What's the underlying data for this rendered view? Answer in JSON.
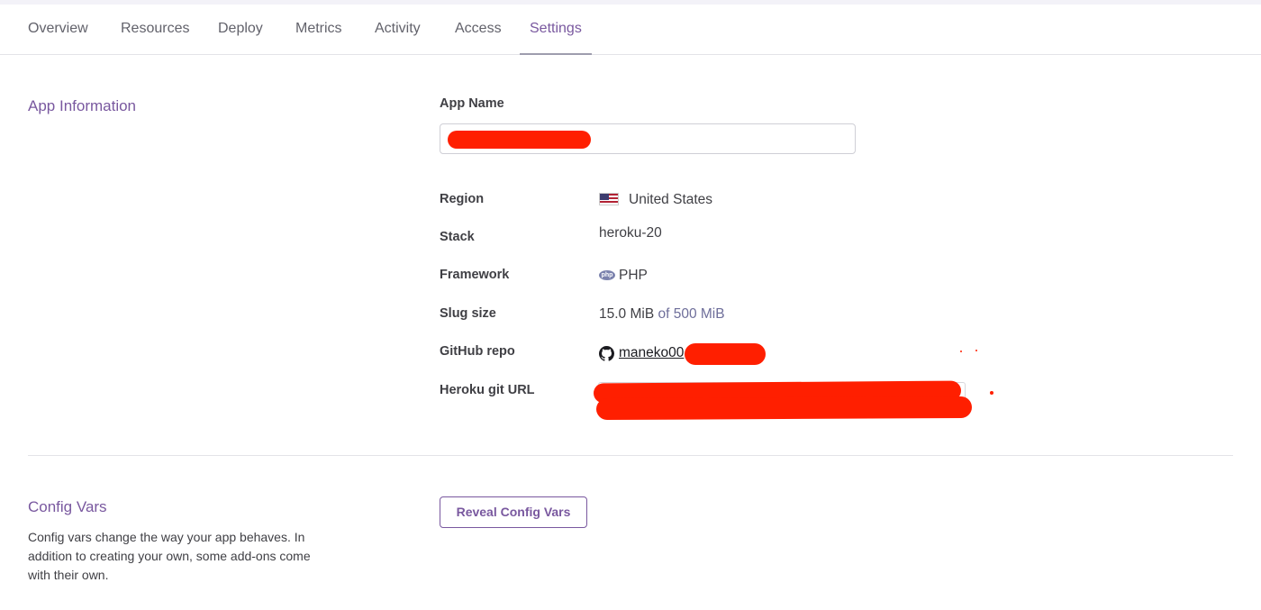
{
  "tabs": [
    {
      "label": "Overview"
    },
    {
      "label": "Resources"
    },
    {
      "label": "Deploy"
    },
    {
      "label": "Metrics"
    },
    {
      "label": "Activity"
    },
    {
      "label": "Access"
    },
    {
      "label": "Settings",
      "active": true
    }
  ],
  "app_info": {
    "title": "App Information",
    "app_name_label": "App Name",
    "app_name_value": "",
    "rows": {
      "region": {
        "label": "Region",
        "value": "United States",
        "icon": "us-flag-icon"
      },
      "stack": {
        "label": "Stack",
        "value": "heroku-20"
      },
      "framework": {
        "label": "Framework",
        "value": "PHP",
        "icon": "php-icon"
      },
      "slug": {
        "label": "Slug size",
        "value": "15.0 MiB",
        "suffix": "of 500 MiB"
      },
      "github": {
        "label": "GitHub repo",
        "value": "maneko00",
        "icon": "github-icon"
      },
      "git_url": {
        "label": "Heroku git URL",
        "value": ""
      }
    }
  },
  "config_vars": {
    "title": "Config Vars",
    "description": "Config vars change the way your app behaves. In addition to creating your own, some add-ons come with their own.",
    "reveal_button": "Reveal Config Vars"
  },
  "colors": {
    "accent": "#79589f",
    "redaction": "#ff1f00",
    "text": "#3f3f44"
  }
}
